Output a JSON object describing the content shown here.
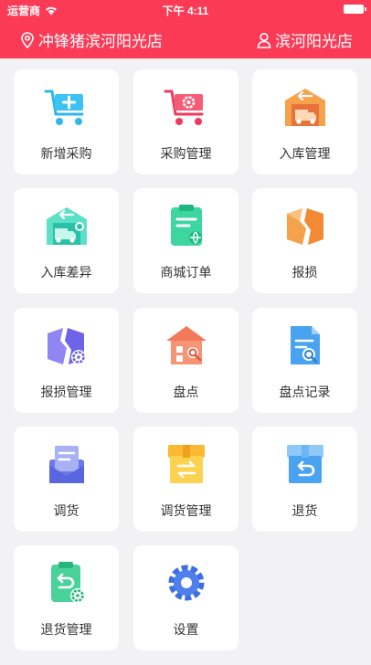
{
  "status_bar": {
    "carrier": "运营商",
    "time": "下午 4:11"
  },
  "header": {
    "store_name": "冲锋猪滨河阳光店",
    "user_store": "滨河阳光店"
  },
  "menu": [
    {
      "label": "新增采购",
      "icon": "add-cart-icon"
    },
    {
      "label": "采购管理",
      "icon": "cart-settings-icon"
    },
    {
      "label": "入库管理",
      "icon": "warehouse-truck-icon"
    },
    {
      "label": "入库差异",
      "icon": "warehouse-difference-icon"
    },
    {
      "label": "商城订单",
      "icon": "order-clipboard-icon"
    },
    {
      "label": "报损",
      "icon": "broken-box-icon"
    },
    {
      "label": "报损管理",
      "icon": "broken-box-settings-icon"
    },
    {
      "label": "盘点",
      "icon": "store-search-icon"
    },
    {
      "label": "盘点记录",
      "icon": "document-search-icon"
    },
    {
      "label": "调货",
      "icon": "mail-tray-icon"
    },
    {
      "label": "调货管理",
      "icon": "box-transfer-icon"
    },
    {
      "label": "退货",
      "icon": "box-return-icon"
    },
    {
      "label": "退货管理",
      "icon": "clipboard-return-settings-icon"
    },
    {
      "label": "设置",
      "icon": "gear-icon"
    }
  ]
}
